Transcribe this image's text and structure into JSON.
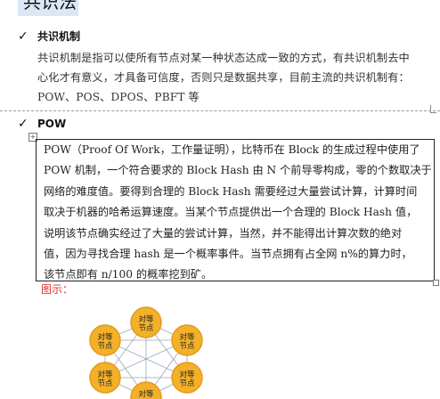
{
  "top_heading": "共识法",
  "sections": [
    {
      "title": "共识机制",
      "paragraph_lines": [
        "共识机制是指可以使所有节点对某一种状态达成一致的方式，有共识机制去中",
        "心化才有意义，才具备可信度，否则只是数据共享，目前主流的共识机制有：",
        "POW、POS、DPOS、PBFT 等"
      ]
    },
    {
      "title": "POW",
      "paragraph_lines": [
        "POW（Proof Of Work，工作量证明），比特币在 Block 的生成过程中使用了",
        "POW 机制，一个符合要求的 Block Hash 由 N 个前导零构成，零的个数取决于",
        "网络的难度值。要得到合理的 Block Hash 需要经过大量尝试计算，计算时间",
        "取决于机器的哈希运算速度。当某个节点提供出一个合理的 Block Hash 值，",
        "说明该节点确实经过了大量的尝试计算，当然，并不能得出计算次数的绝对",
        "值，因为寻找合理 hash 是一个概率事件。当节点拥有占全网 n%的算力时，",
        "该节点即有 n/100 的概率挖到矿。"
      ]
    }
  ],
  "figure_label": "图示：",
  "diagram": {
    "nodes": [
      {
        "line1": "对等",
        "line2": "节点"
      },
      {
        "line1": "对等",
        "line2": "节点"
      },
      {
        "line1": "对等",
        "line2": "节点"
      },
      {
        "line1": "对等",
        "line2": "节点"
      },
      {
        "line1": "对等",
        "line2": "节点"
      },
      {
        "line1": "对等",
        "line2": "节点"
      }
    ],
    "colors": {
      "node_fill": "#f3b12a",
      "node_stroke": "#e39a1a",
      "edge": "#9aa7b8"
    }
  },
  "icons": {
    "check": "checkmark-icon",
    "table_move": "move-handle-icon"
  }
}
